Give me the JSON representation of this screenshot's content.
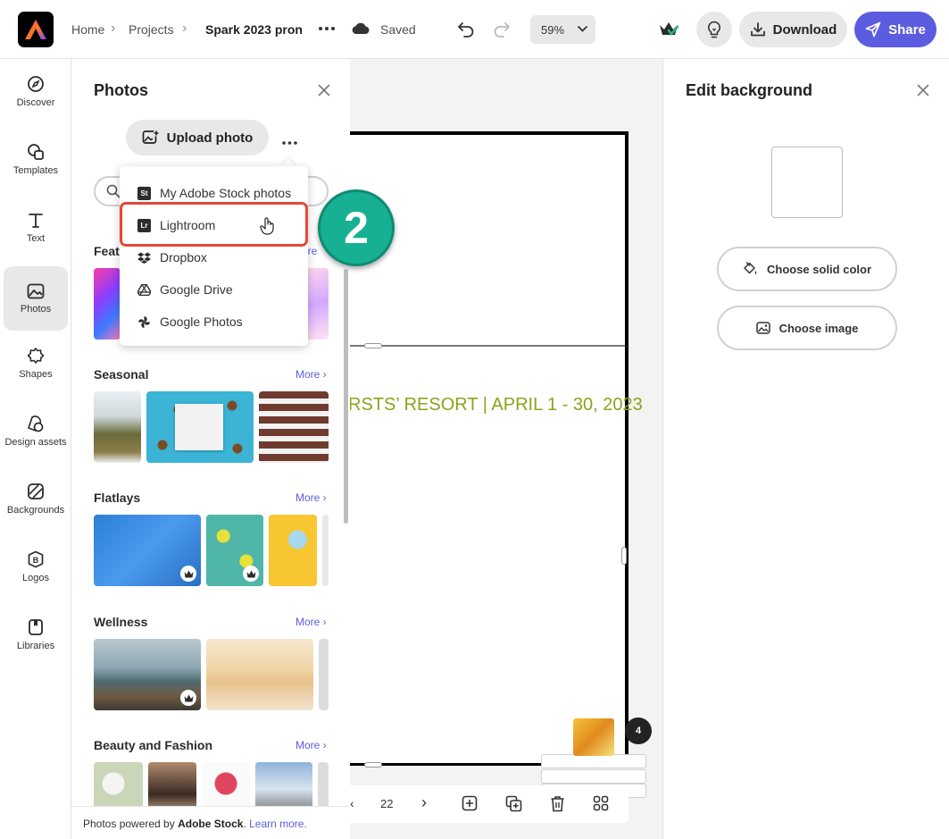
{
  "header": {
    "breadcrumbs": [
      "Home",
      "Projects"
    ],
    "project_title": "Spark 2023 pron",
    "save_status": "Saved",
    "zoom": "59%",
    "download_label": "Download",
    "share_label": "Share"
  },
  "rail": {
    "items": [
      {
        "label": "Discover",
        "icon": "compass-icon"
      },
      {
        "label": "Templates",
        "icon": "templates-icon"
      },
      {
        "label": "Text",
        "icon": "text-icon"
      },
      {
        "label": "Photos",
        "icon": "photos-icon",
        "active": true
      },
      {
        "label": "Shapes",
        "icon": "shapes-icon"
      },
      {
        "label": "Design assets",
        "icon": "design-assets-icon"
      },
      {
        "label": "Backgrounds",
        "icon": "backgrounds-icon"
      },
      {
        "label": "Logos",
        "icon": "logos-icon"
      },
      {
        "label": "Libraries",
        "icon": "libraries-icon"
      }
    ]
  },
  "photos_panel": {
    "title": "Photos",
    "upload_label": "Upload photo",
    "featured_partial": "Featu",
    "featured_more_partial": "ore",
    "sections": [
      {
        "title": "Seasonal",
        "more": "More"
      },
      {
        "title": "Flatlays",
        "more": "More"
      },
      {
        "title": "Wellness",
        "more": "More"
      },
      {
        "title": "Beauty and Fashion",
        "more": "More"
      }
    ],
    "footer": {
      "prefix": "Photos powered by ",
      "brand": "Adobe Stock",
      "suffix": ". ",
      "link": "Learn more."
    }
  },
  "dropdown": {
    "items": [
      {
        "label": "My Adobe Stock photos",
        "badge": "St"
      },
      {
        "label": "Lightroom",
        "badge": "Lr",
        "highlighted": true
      },
      {
        "label": "Dropbox",
        "icon": "dropbox-icon"
      },
      {
        "label": "Google Drive",
        "icon": "google-drive-icon"
      },
      {
        "label": "Google Photos",
        "icon": "google-photos-icon"
      }
    ],
    "callout_number": "2"
  },
  "canvas": {
    "headline": "RSTS’ RESORT | APRIL 1 - 30, 2023",
    "page_number": "22",
    "page_count_badge": "4"
  },
  "right_panel": {
    "title": "Edit background",
    "solid_color_label": "Choose solid color",
    "image_label": "Choose image"
  },
  "colors": {
    "accent": "#5c5ce0",
    "highlight_border": "#e6473a",
    "callout": "#17b092",
    "headline": "#8ba31c"
  }
}
